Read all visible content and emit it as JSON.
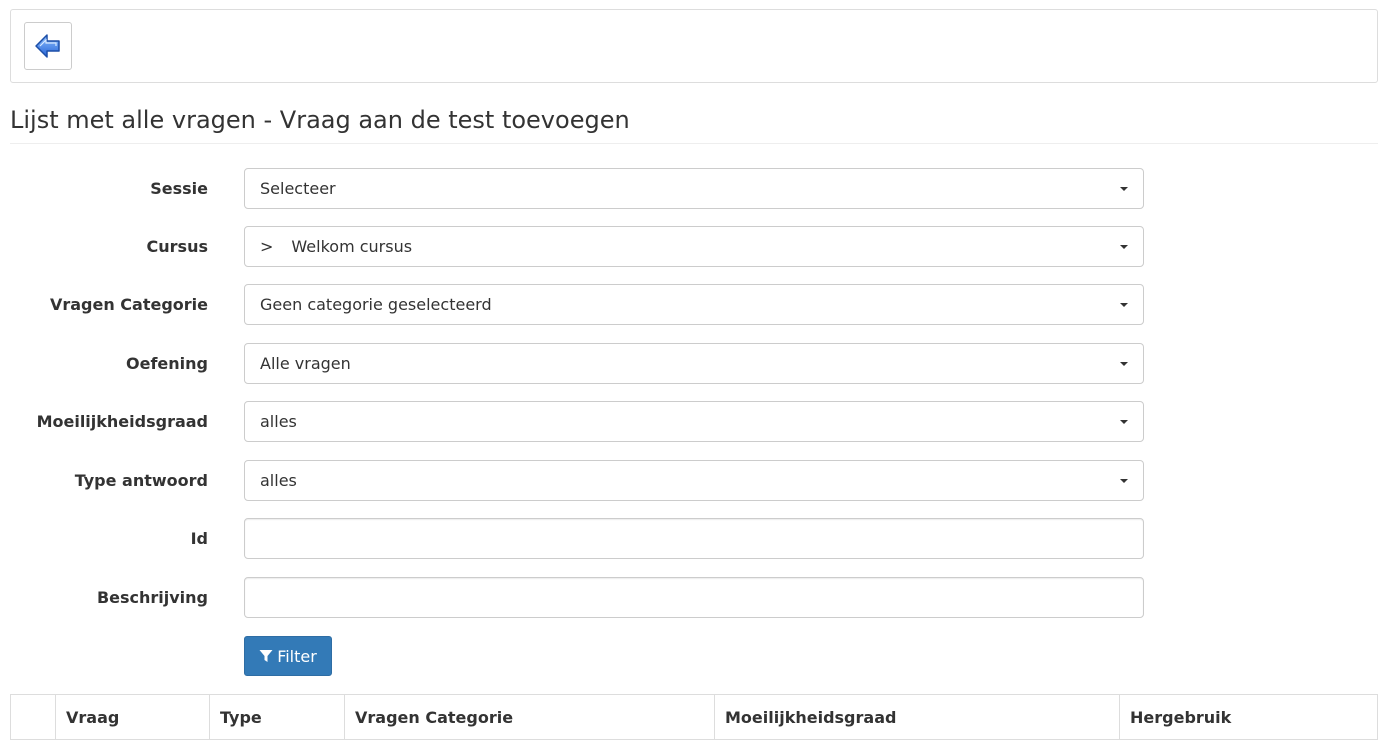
{
  "toolbar": {
    "back_icon": "back-arrow-icon"
  },
  "page": {
    "title": "Lijst met alle vragen - Vraag aan de test toevoegen"
  },
  "filters": {
    "sessie": {
      "label": "Sessie",
      "value": "Selecteer"
    },
    "cursus": {
      "label": "Cursus",
      "prefix": ">",
      "value": "Welkom cursus"
    },
    "categorie": {
      "label": "Vragen Categorie",
      "value": "Geen categorie geselecteerd"
    },
    "oefening": {
      "label": "Oefening",
      "value": "Alle vragen"
    },
    "moeilijkheid": {
      "label": "Moeilijkheidsgraad",
      "value": "alles"
    },
    "type": {
      "label": "Type antwoord",
      "value": "alles"
    },
    "id": {
      "label": "Id",
      "value": ""
    },
    "beschrijving": {
      "label": "Beschrijving",
      "value": ""
    },
    "filter_button": "Filter"
  },
  "table": {
    "columns": [
      "",
      "Vraag",
      "Type",
      "Vragen Categorie",
      "Moeilijkheidsgraad",
      "Hergebruik"
    ]
  },
  "colors": {
    "primary": "#337ab7",
    "border": "#cccccc",
    "icon_blue": "#2a6fd6"
  }
}
